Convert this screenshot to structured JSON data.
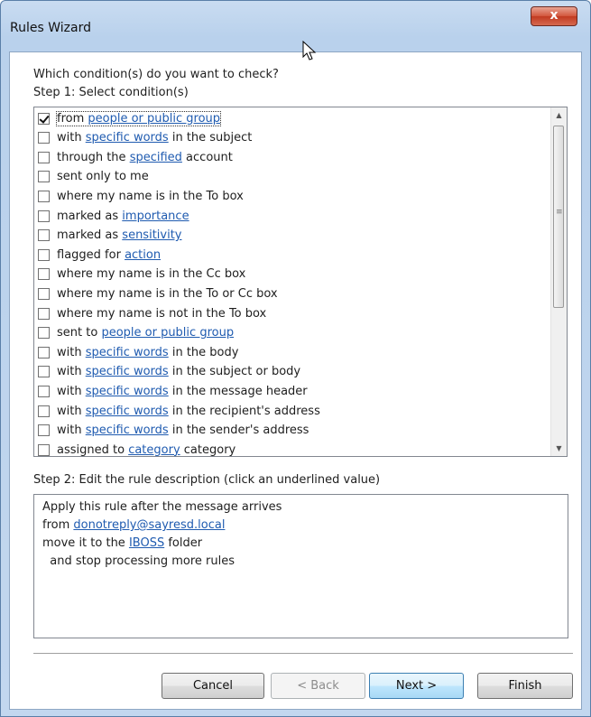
{
  "window": {
    "title": "Rules Wizard",
    "close_glyph": "x"
  },
  "question": "Which condition(s) do you want to check?",
  "step1_label": "Step 1: Select condition(s)",
  "conditions": [
    {
      "checked": true,
      "parts": [
        {
          "t": "from "
        },
        {
          "t": "people or public group",
          "link": true
        }
      ]
    },
    {
      "checked": false,
      "parts": [
        {
          "t": "with "
        },
        {
          "t": "specific words",
          "link": true
        },
        {
          "t": " in the subject"
        }
      ]
    },
    {
      "checked": false,
      "parts": [
        {
          "t": "through the "
        },
        {
          "t": "specified",
          "link": true
        },
        {
          "t": " account"
        }
      ]
    },
    {
      "checked": false,
      "parts": [
        {
          "t": "sent only to me"
        }
      ]
    },
    {
      "checked": false,
      "parts": [
        {
          "t": "where my name is in the To box"
        }
      ]
    },
    {
      "checked": false,
      "parts": [
        {
          "t": "marked as "
        },
        {
          "t": "importance",
          "link": true
        }
      ]
    },
    {
      "checked": false,
      "parts": [
        {
          "t": "marked as "
        },
        {
          "t": "sensitivity",
          "link": true
        }
      ]
    },
    {
      "checked": false,
      "parts": [
        {
          "t": "flagged for "
        },
        {
          "t": "action",
          "link": true
        }
      ]
    },
    {
      "checked": false,
      "parts": [
        {
          "t": "where my name is in the Cc box"
        }
      ]
    },
    {
      "checked": false,
      "parts": [
        {
          "t": "where my name is in the To or Cc box"
        }
      ]
    },
    {
      "checked": false,
      "parts": [
        {
          "t": "where my name is not in the To box"
        }
      ]
    },
    {
      "checked": false,
      "parts": [
        {
          "t": "sent to "
        },
        {
          "t": "people or public group",
          "link": true
        }
      ]
    },
    {
      "checked": false,
      "parts": [
        {
          "t": "with "
        },
        {
          "t": "specific words",
          "link": true
        },
        {
          "t": " in the body"
        }
      ]
    },
    {
      "checked": false,
      "parts": [
        {
          "t": "with "
        },
        {
          "t": "specific words",
          "link": true
        },
        {
          "t": " in the subject or body"
        }
      ]
    },
    {
      "checked": false,
      "parts": [
        {
          "t": "with "
        },
        {
          "t": "specific words",
          "link": true
        },
        {
          "t": " in the message header"
        }
      ]
    },
    {
      "checked": false,
      "parts": [
        {
          "t": "with "
        },
        {
          "t": "specific words",
          "link": true
        },
        {
          "t": " in the recipient's address"
        }
      ]
    },
    {
      "checked": false,
      "parts": [
        {
          "t": "with "
        },
        {
          "t": "specific words",
          "link": true
        },
        {
          "t": " in the sender's address"
        }
      ]
    },
    {
      "checked": false,
      "parts": [
        {
          "t": "assigned to "
        },
        {
          "t": "category",
          "link": true
        },
        {
          "t": " category"
        }
      ]
    }
  ],
  "step2_label": "Step 2: Edit the rule description (click an underlined value)",
  "description": [
    [
      {
        "t": "Apply this rule after the message arrives"
      }
    ],
    [
      {
        "t": "from "
      },
      {
        "t": "donotreply@sayresd.local",
        "link": true
      }
    ],
    [
      {
        "t": "move it to the "
      },
      {
        "t": "IBOSS",
        "link": true
      },
      {
        "t": " folder"
      }
    ],
    [
      {
        "t": "  and stop processing more rules"
      }
    ]
  ],
  "buttons": {
    "cancel": "Cancel",
    "back": "< Back",
    "next": "Next >",
    "finish": "Finish"
  },
  "icons": {
    "close": "close-icon",
    "check": "check-icon",
    "cursor": "mouse-pointer-icon"
  }
}
